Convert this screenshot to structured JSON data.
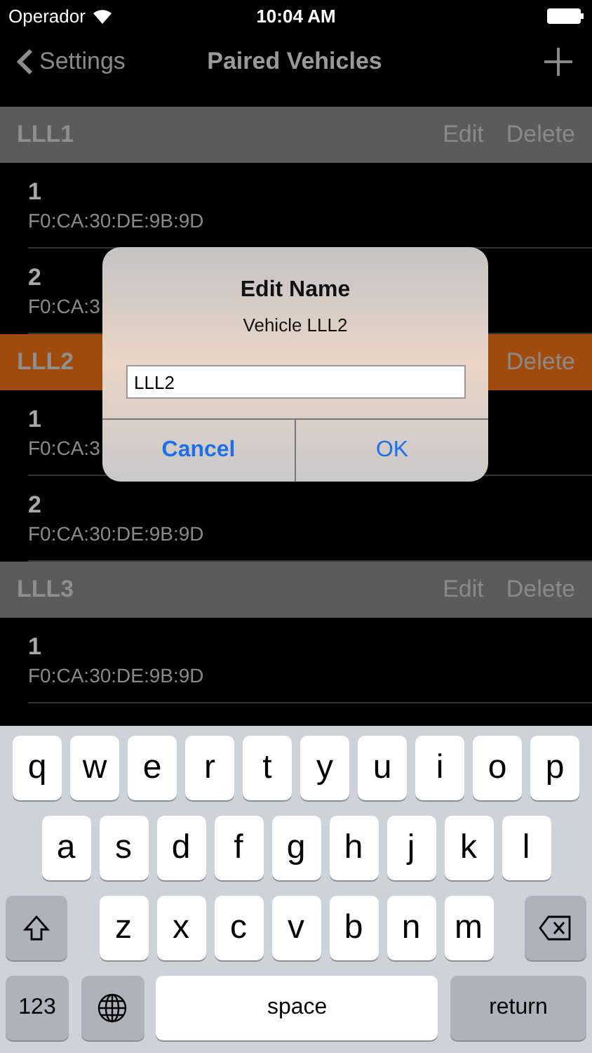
{
  "status_bar": {
    "carrier": "Operador",
    "time": "10:04 AM"
  },
  "nav": {
    "back": "Settings",
    "title": "Paired Vehicles"
  },
  "sections": [
    {
      "title": "LLL1",
      "selected": false,
      "actions": [
        "Edit",
        "Delete"
      ],
      "rows": [
        {
          "number": "1",
          "address": "F0:CA:30:DE:9B:9D"
        },
        {
          "number": "2",
          "address": "F0:CA:3"
        }
      ]
    },
    {
      "title": "LLL2",
      "selected": true,
      "actions": [
        "Delete"
      ],
      "rows": [
        {
          "number": "1",
          "address": "F0:CA:3"
        },
        {
          "number": "2",
          "address": "F0:CA:30:DE:9B:9D"
        }
      ]
    },
    {
      "title": "LLL3",
      "selected": false,
      "actions": [
        "Edit",
        "Delete"
      ],
      "rows": [
        {
          "number": "1",
          "address": "F0:CA:30:DE:9B:9D"
        }
      ]
    }
  ],
  "dialog": {
    "title": "Edit Name",
    "message": "Vehicle LLL2",
    "value": "LLL2",
    "buttons": [
      {
        "label": "Cancel",
        "kind": "cancel"
      },
      {
        "label": "OK",
        "kind": "default"
      }
    ]
  },
  "keyboard": [
    [
      {
        "kind": "letter",
        "label": "q"
      },
      {
        "kind": "letter",
        "label": "w"
      },
      {
        "kind": "letter",
        "label": "e"
      },
      {
        "kind": "letter",
        "label": "r"
      },
      {
        "kind": "letter",
        "label": "t"
      },
      {
        "kind": "letter",
        "label": "y"
      },
      {
        "kind": "letter",
        "label": "u"
      },
      {
        "kind": "letter",
        "label": "i"
      },
      {
        "kind": "letter",
        "label": "o"
      },
      {
        "kind": "letter",
        "label": "p"
      }
    ],
    [
      {
        "kind": "letter",
        "label": "a"
      },
      {
        "kind": "letter",
        "label": "s"
      },
      {
        "kind": "letter",
        "label": "d"
      },
      {
        "kind": "letter",
        "label": "f"
      },
      {
        "kind": "letter",
        "label": "g"
      },
      {
        "kind": "letter",
        "label": "h"
      },
      {
        "kind": "letter",
        "label": "j"
      },
      {
        "kind": "letter",
        "label": "k"
      },
      {
        "kind": "letter",
        "label": "l"
      }
    ],
    [
      {
        "kind": "shift"
      },
      {
        "kind": "letter",
        "label": "z"
      },
      {
        "kind": "letter",
        "label": "x"
      },
      {
        "kind": "letter",
        "label": "c"
      },
      {
        "kind": "letter",
        "label": "v"
      },
      {
        "kind": "letter",
        "label": "b"
      },
      {
        "kind": "letter",
        "label": "n"
      },
      {
        "kind": "letter",
        "label": "m"
      },
      {
        "kind": "delete"
      }
    ],
    [
      {
        "kind": "numbers",
        "label": "123"
      },
      {
        "kind": "globe"
      },
      {
        "kind": "space",
        "label": "space"
      },
      {
        "kind": "return",
        "label": "return"
      }
    ]
  ]
}
